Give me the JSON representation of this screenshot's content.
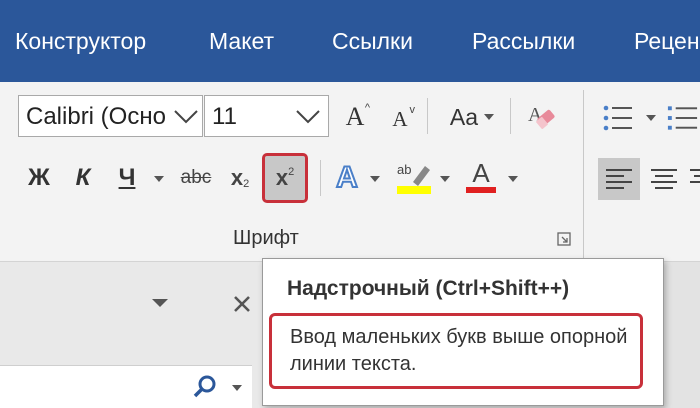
{
  "tabs": [
    "Конструктор",
    "Макет",
    "Ссылки",
    "Рассылки",
    "Рецен"
  ],
  "font": {
    "name_value": "Calibri (Осно",
    "size_value": "11",
    "group_label": "Шрифт"
  },
  "buttons": {
    "bold": "Ж",
    "italic": "К",
    "underline": "Ч",
    "strike": "abc",
    "subscript": "x",
    "subscript_mark": "2",
    "superscript": "x",
    "superscript_mark": "2",
    "grow_a": "A",
    "shrink_a": "A",
    "change_case": "Aa",
    "text_effects": "A",
    "highlight": "ab",
    "font_color": "A"
  },
  "tooltip": {
    "title": "Надстрочный (Ctrl+Shift++)",
    "description": "Ввод маленьких букв выше опорной линии текста."
  },
  "colors": {
    "ribbon_tab_bg": "#2b579a",
    "highlight_red": "#c8303a",
    "highlight_yellow": "#ffff00",
    "font_color_red": "#e02020",
    "text_effects_blue": "#4a7fc8"
  }
}
